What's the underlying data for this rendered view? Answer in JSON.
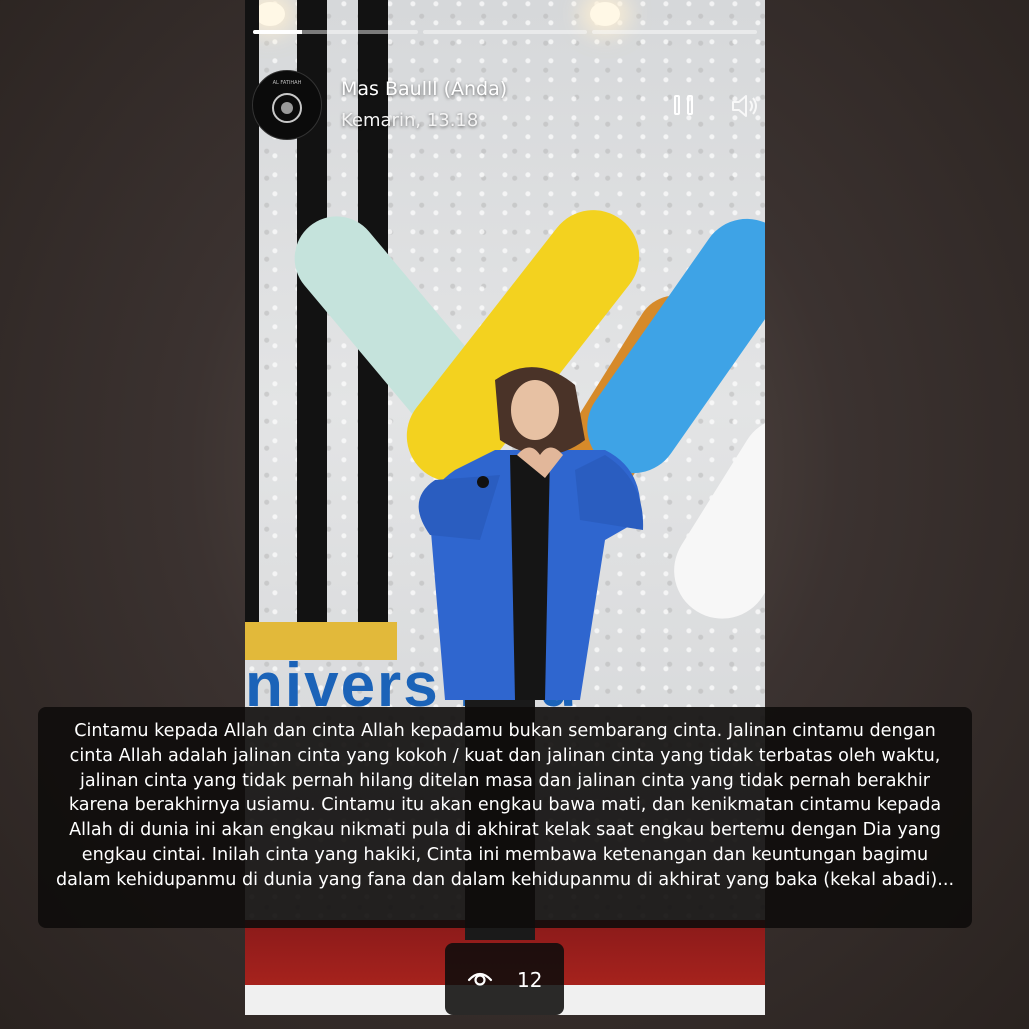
{
  "story": {
    "author": "Mas Baulll (Anda)",
    "timestamp": "Kemarin, 13.18",
    "progress_segments": [
      0.3,
      0,
      0
    ],
    "background_sign_text": "nivers    ngu",
    "avatar_caption_top": "AL FATIHAH",
    "colors": {
      "sign_blue": "#1b63b8",
      "logo_yellow": "#f3d21f",
      "logo_mint": "#c5e3dc",
      "logo_sky": "#3ea3e6",
      "logo_orange": "#d68a2a",
      "jacket_blue": "#2f66cf"
    }
  },
  "controls": {
    "pause_icon": "pause-icon",
    "volume_icon": "volume-icon"
  },
  "caption": {
    "text": "Cintamu kepada Allah dan cinta Allah kepadamu bukan sembarang cinta. Jalinan cintamu dengan cinta Allah adalah jalinan cinta yang kokoh / kuat dan jalinan cinta yang tidak terbatas oleh waktu, jalinan cinta yang tidak pernah hilang ditelan masa dan jalinan cinta yang tidak pernah berakhir karena berakhirnya usiamu. Cintamu itu akan engkau bawa mati, dan kenikmatan cintamu kepada Allah di dunia ini akan engkau nikmati pula di akhirat kelak saat engkau bertemu dengan Dia yang engkau cintai. Inilah cinta yang hakiki, Cinta ini membawa ketenangan dan keuntungan bagimu dalam kehidupanmu di dunia yang fana dan dalam kehidupanmu di akhirat yang baka (kekal abadi)..."
  },
  "viewers": {
    "icon": "eye-icon",
    "count": "12"
  }
}
